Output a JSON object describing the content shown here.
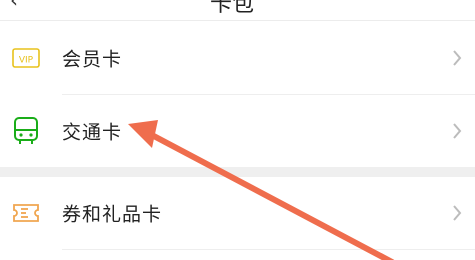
{
  "header": {
    "back_glyph": "‹",
    "title": "卡包"
  },
  "colors": {
    "vip_icon": "#e8c21c",
    "transit_icon": "#1aad19",
    "coupon_icon": "#f0a650",
    "annotation_arrow": "#ef6d4d",
    "chevron": "#bcbcbc"
  },
  "menu": {
    "items": [
      {
        "label": "会员卡",
        "icon": "vip-card-icon"
      },
      {
        "label": "交通卡",
        "icon": "bus-icon"
      },
      {
        "label": "券和礼品卡",
        "icon": "ticket-icon"
      }
    ]
  },
  "overlay": {
    "annotation": "arrow-pointing-to-交通卡"
  }
}
